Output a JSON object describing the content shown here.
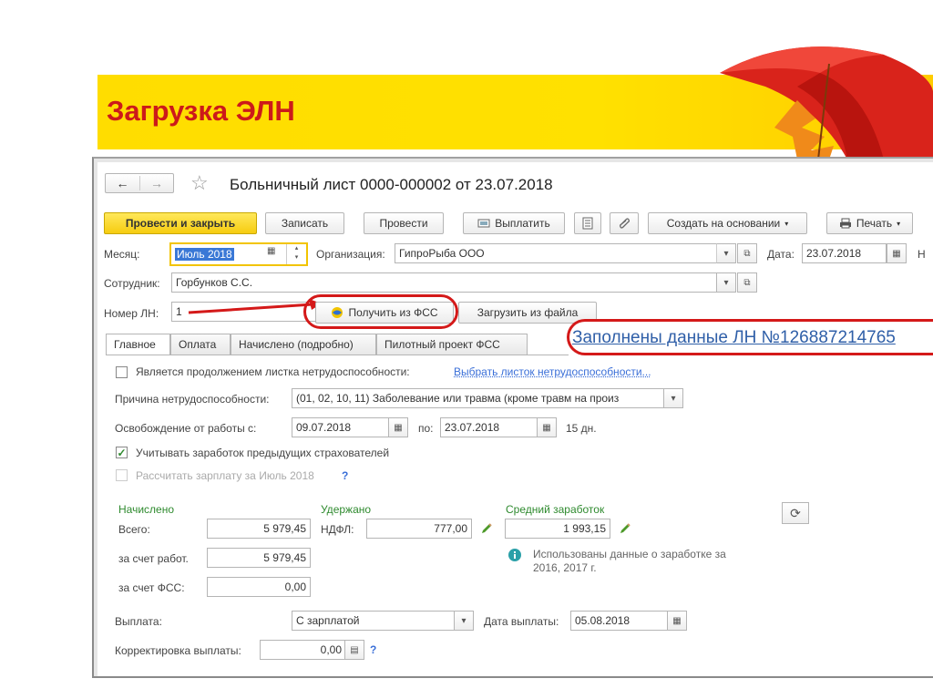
{
  "banner": {
    "title": "Загрузка ЭЛН"
  },
  "doc": {
    "title": "Больничный лист 0000-000002 от 23.07.2018",
    "nav_back": "←",
    "nav_forward": "→",
    "star": "☆"
  },
  "toolbar": {
    "post_close": "Провести и закрыть",
    "save": "Записать",
    "post": "Провести",
    "pay": "Выплатить",
    "create_based": "Создать на основании",
    "print": "Печать"
  },
  "header": {
    "month_label": "Месяц:",
    "month_value": "Июль 2018",
    "org_label": "Организация:",
    "org_value": "ГипроРыба ООО",
    "date_label": "Дата:",
    "date_value": "23.07.2018",
    "cut_label": "Н",
    "employee_label": "Сотрудник:",
    "employee_value": "Горбунков С.С.",
    "ln_label": "Номер ЛН:",
    "ln_value": "1",
    "get_fss": "Получить из ФСС",
    "load_file": "Загрузить из файла",
    "callout": "Заполнены данные ЛН №126887214765"
  },
  "tabs": [
    "Главное",
    "Оплата",
    "Начислено (подробно)",
    "Пилотный проект ФСС"
  ],
  "main": {
    "continuation_label": "Является продолжением листка нетрудоспособности:",
    "continuation_link": "Выбрать листок нетрудоспособности...",
    "reason_label": "Причина нетрудоспособности:",
    "reason_value": "(01, 02, 10, 11) Заболевание или травма (кроме травм на произ",
    "release_label": "Освобождение от работы с:",
    "release_from": "09.07.2018",
    "release_to_label": "по:",
    "release_to": "23.07.2018",
    "days": "15 дн.",
    "prev_insurers_label": "Учитывать заработок предыдущих страхователей",
    "calc_salary_label": "Рассчитать зарплату за Июль 2018",
    "help": "?"
  },
  "accrued": {
    "header": "Начислено",
    "total_label": "Всего:",
    "total_value": "5 979,45",
    "employer_label": "за счет работ.",
    "employer_value": "5 979,45",
    "fss_label": "за счет ФСС:",
    "fss_value": "0,00"
  },
  "withheld": {
    "header": "Удержано",
    "ndfl_label": "НДФЛ:",
    "ndfl_value": "777,00"
  },
  "average": {
    "header": "Средний заработок",
    "value": "1 993,15",
    "info": "Использованы данные о заработке за 2016, 2017 г."
  },
  "payment": {
    "label": "Выплата:",
    "value": "С зарплатой",
    "date_label": "Дата выплаты:",
    "date_value": "05.08.2018",
    "adjust_label": "Корректировка выплаты:",
    "adjust_value": "0,00"
  },
  "colors": {
    "primary": "#f6cc10",
    "accent_red": "#d41919",
    "link_blue": "#3a6fd8",
    "green": "#2e8a2e",
    "banner_title": "#cc1a1a"
  }
}
